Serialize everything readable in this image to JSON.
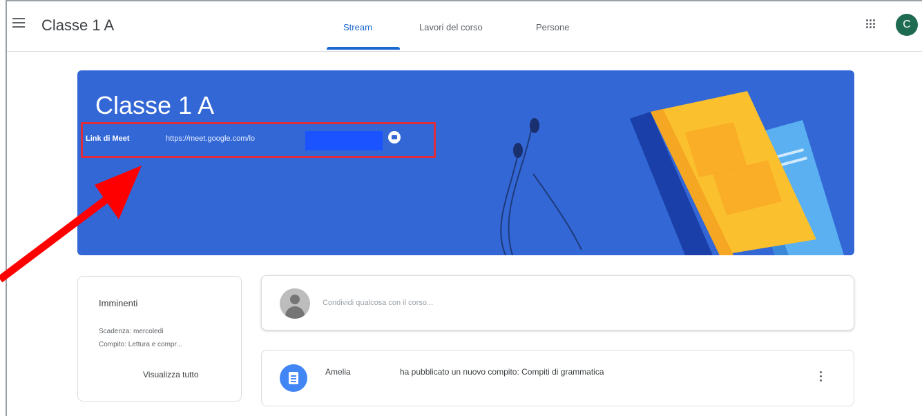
{
  "header": {
    "class_name": "Classe 1 A",
    "tabs": [
      {
        "label": "Stream",
        "active": true
      },
      {
        "label": "Lavori del corso",
        "active": false
      },
      {
        "label": "Persone",
        "active": false
      }
    ],
    "avatar_letter": "C"
  },
  "banner": {
    "title": "Classe 1 A",
    "meet_label": "Link di Meet",
    "meet_url": "https://meet.google.com/lo"
  },
  "upcoming": {
    "title": "Imminenti",
    "due": "Scadenza: mercoledì",
    "task": "Compito: Lettura e compr...",
    "view_all": "Visualizza tutto"
  },
  "share": {
    "placeholder": "Condividi qualcosa con il corso..."
  },
  "post": {
    "author": "Amelia",
    "text": "ha pubblicato un nuovo compito: Compiti di grammatica"
  },
  "colors": {
    "banner": "#3367d6",
    "accent": "#1967d2",
    "annotation": "#e02d3c",
    "avatar": "#1e6b52"
  },
  "icons": [
    "menu-icon",
    "apps-icon",
    "meet-icon",
    "assignment-icon",
    "more-vert-icon",
    "avatar-placeholder-icon"
  ]
}
